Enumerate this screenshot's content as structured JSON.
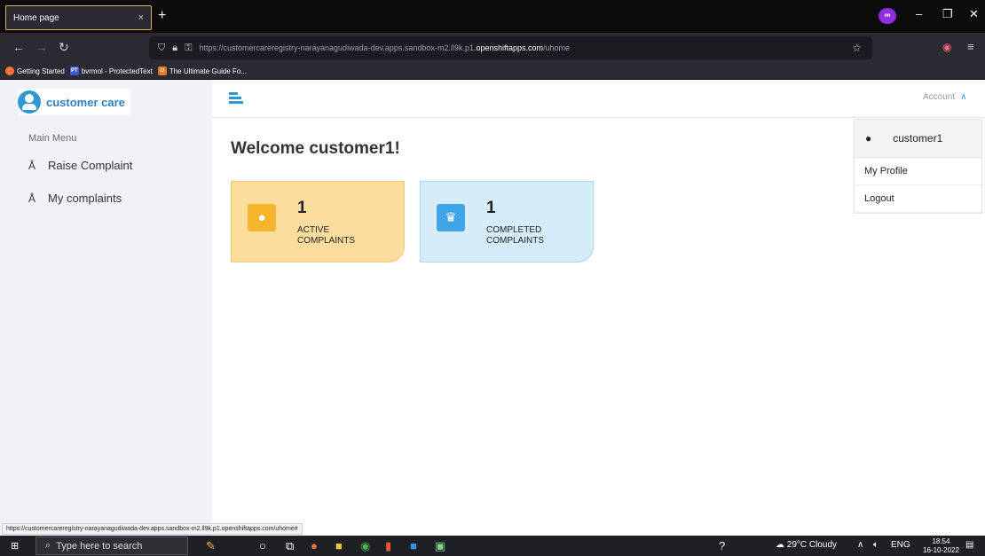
{
  "browser": {
    "tab_title": "Home page",
    "tab_close": "×",
    "new_tab": "+",
    "url_prefix": "https://customercareregistry-narayanagudiwada-dev.apps.sandbox-m2.ll9k.p1.",
    "url_domain": "openshiftapps.com",
    "url_suffix": "/uhome",
    "bookmarks": [
      {
        "label": "Getting Started",
        "icon": "firefox-icon",
        "color": "#ff7139"
      },
      {
        "label": "bvrmol - ProtectedText",
        "icon": "protectedtext-icon",
        "color": "#3a5bd9"
      },
      {
        "label": "The Ultimate Guide Fo...",
        "icon": "guide-icon",
        "color": "#e07b22"
      }
    ],
    "status_url": "https://customercareregistry-narayanagudiwada-dev.apps.sandbox-m2.ll9k.p1.openshiftapps.com/uhome#"
  },
  "app": {
    "logo_text": "customer care",
    "menu_heading": "Main Menu",
    "sidebar_items": [
      {
        "label": "Raise Complaint",
        "icon": "person-icon"
      },
      {
        "label": "My complaints",
        "icon": "person-icon"
      }
    ],
    "account_label": "Account",
    "dropdown": {
      "username": "customer1",
      "items": [
        "My Profile",
        "Logout"
      ]
    },
    "welcome": "Welcome customer1!",
    "cards": [
      {
        "count": "1",
        "label": "ACTIVE COMPLAINTS",
        "icon": "user-icon",
        "color": "#f7b52c"
      },
      {
        "count": "1",
        "label": "COMPLETED COMPLAINTS",
        "icon": "crown-icon",
        "color": "#3fa5e6"
      }
    ]
  },
  "taskbar": {
    "search_placeholder": "Type here to search",
    "weather": "29°C  Cloudy",
    "lang": "ENG",
    "time": "18:54",
    "date": "16-10-2022"
  }
}
